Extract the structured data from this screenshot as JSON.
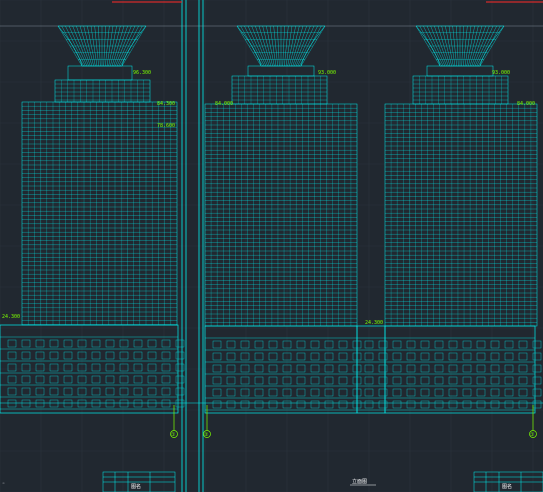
{
  "drawing": {
    "colors": {
      "background": "#212830",
      "grid": "#2b333c",
      "linework": "#00F0F0",
      "labels": "#7CFF00",
      "border_red": "#D42A2A",
      "white": "#FFFFFF"
    },
    "elevation_labels": {
      "left_crown": "96.300",
      "left_roof": "84.300",
      "left_side": "78.600",
      "left_podium": "24.300",
      "mid_crown": "93.000",
      "mid_roof": "84.000",
      "mid_podium": "24.300",
      "right_crown": "93.000",
      "right_roof": "84.000"
    },
    "grid_axes": {
      "left_axis": "①",
      "mid_axis": "②",
      "right_axis": "①"
    },
    "sheet_title": "立面图",
    "title_block_left_label": "图名",
    "title_block_right_label": "图名"
  }
}
